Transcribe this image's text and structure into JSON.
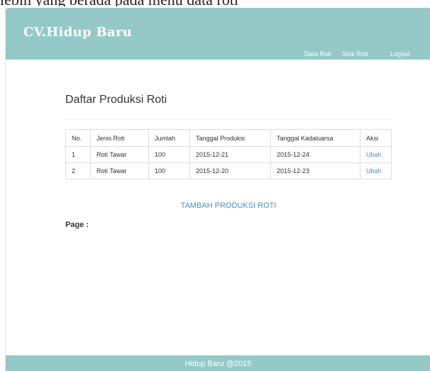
{
  "top_text": "lebih yang berada pada menu data roti",
  "navbar": {
    "brand": "CV.Hidup Baru",
    "links": [
      "Data Roti",
      "Stok Roti",
      "Logout"
    ]
  },
  "main": {
    "title": "Daftar Produksi Roti",
    "table": {
      "headers": [
        "No.",
        "Jenis Roti",
        "Jumlah",
        "Tanggal Produksi",
        "Tanggal Kadaluarsa",
        "Aksi"
      ],
      "rows": [
        [
          "1",
          "Roti Tawar",
          "100",
          "2015-12-21",
          "2015-12-24",
          "Ubah"
        ],
        [
          "2",
          "Roti Tawar",
          "100",
          "2015-12-20",
          "2015-12-23",
          "Ubah"
        ]
      ]
    },
    "add_link": "TAMBAH PRODUKSI ROTI",
    "page_label": "Page :"
  },
  "footer": {
    "text": "Hidup Baru @2015"
  },
  "colors": {
    "navbar": "#94c9c8",
    "link": "#4a8fd1"
  }
}
